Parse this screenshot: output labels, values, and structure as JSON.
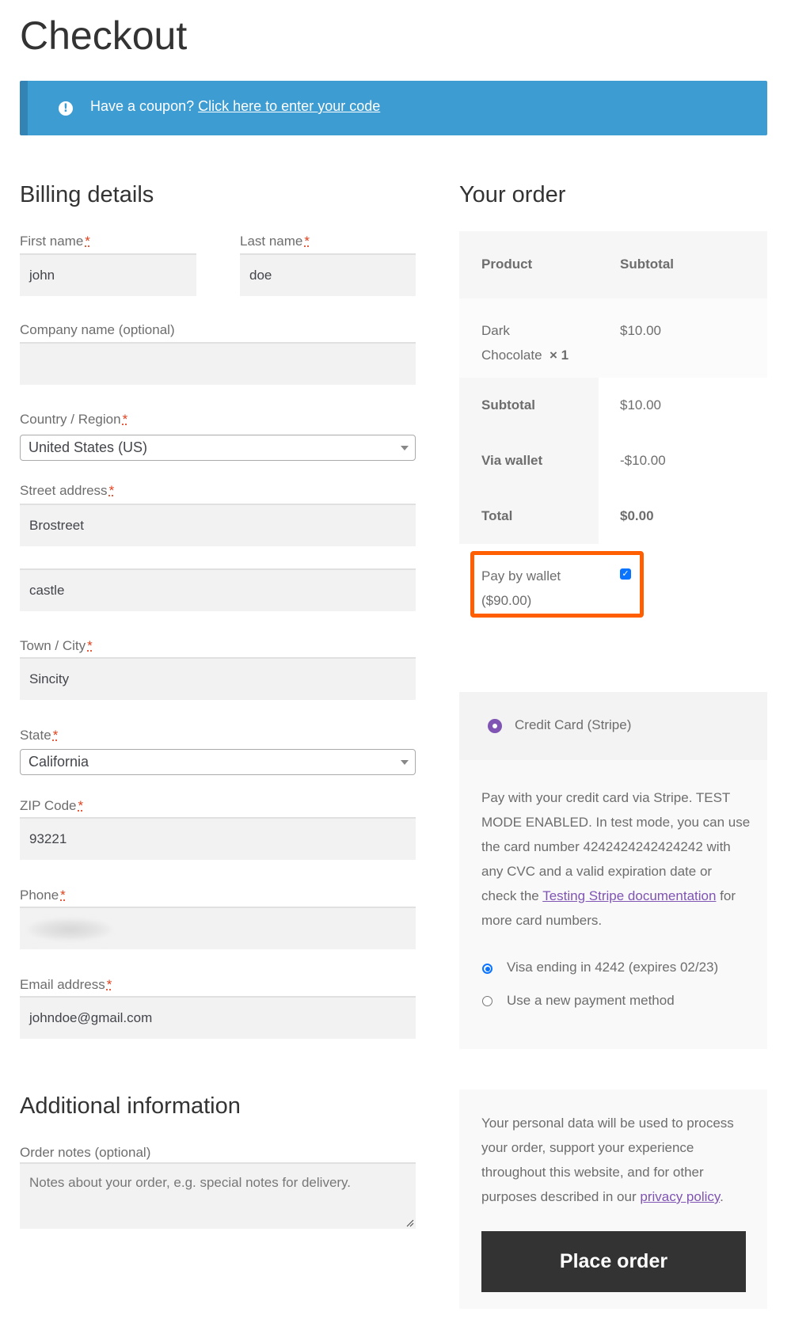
{
  "page": {
    "title": "Checkout"
  },
  "notice": {
    "icon": "info-icon",
    "text": "Have a coupon?",
    "link": "Click here to enter your code",
    "color": "#3d9cd2"
  },
  "billing": {
    "heading": "Billing details",
    "required_marker": "*",
    "fields": {
      "first_name": {
        "label": "First name",
        "value": "john"
      },
      "last_name": {
        "label": "Last name",
        "value": "doe"
      },
      "company": {
        "label": "Company name (optional)",
        "value": ""
      },
      "country": {
        "label": "Country / Region",
        "value": "United States (US)"
      },
      "street": {
        "label": "Street address",
        "value": "Brostreet",
        "value2": "castle"
      },
      "city": {
        "label": "Town / City",
        "value": "Sincity"
      },
      "state": {
        "label": "State",
        "value": "California"
      },
      "zip": {
        "label": "ZIP Code",
        "value": "93221"
      },
      "phone": {
        "label": "Phone",
        "value": ""
      },
      "email": {
        "label": "Email address",
        "value": "johndoe@gmail.com"
      }
    }
  },
  "additional": {
    "heading": "Additional information",
    "notes_label": "Order notes (optional)",
    "notes_placeholder": "Notes about your order, e.g. special notes for delivery."
  },
  "order": {
    "heading": "Your order",
    "columns": [
      "Product",
      "Subtotal"
    ],
    "items": [
      {
        "name_line1": "Dark",
        "name_line2": "Chocolate",
        "qty": "× 1",
        "subtotal": "$10.00"
      }
    ],
    "totals": [
      {
        "label": "Subtotal",
        "value": "$10.00"
      },
      {
        "label": "Via wallet",
        "value": "-$10.00"
      },
      {
        "label": "Total",
        "value": "$0.00"
      }
    ],
    "wallet": {
      "label": "Pay by wallet",
      "balance": "($90.00)",
      "checked": true,
      "highlight_color": "#ff5f00"
    }
  },
  "payment": {
    "method": "Credit Card (Stripe)",
    "description_1": "Pay with your credit card via Stripe. TEST MODE ENABLED. In test mode, you can use the card number 4242424242424242 with any CVC and a valid expiration date or check the",
    "description_link": "Testing Stripe documentation",
    "description_2": "for more card numbers.",
    "options": [
      {
        "label": "Visa ending in 4242 (expires 02/23)",
        "selected": true
      },
      {
        "label": "Use a new payment method",
        "selected": false
      }
    ],
    "accent": "#7f54b3"
  },
  "privacy": {
    "text": "Your personal data will be used to process your order, support your experience throughout this website, and for other purposes described in our",
    "link": "privacy policy",
    "suffix": "."
  },
  "place_order": {
    "label": "Place order"
  }
}
